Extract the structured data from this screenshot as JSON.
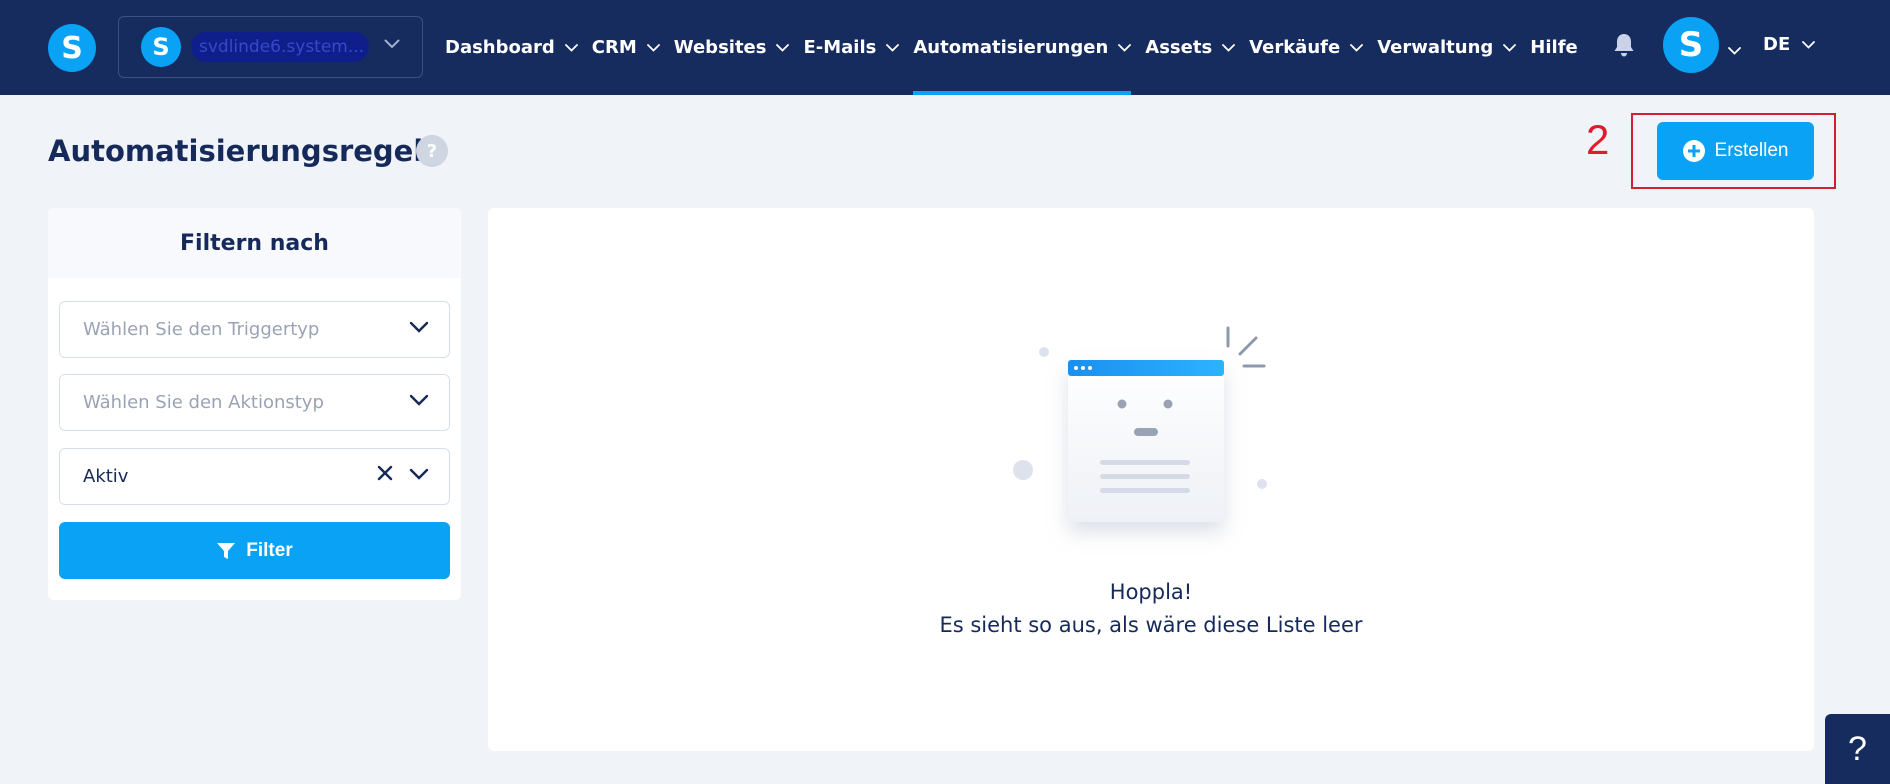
{
  "topbar": {
    "logo_letter": "S",
    "site": {
      "avatar_letter": "S",
      "name": "svdlinde6.system..."
    },
    "nav": [
      {
        "label": "Dashboard",
        "active": false
      },
      {
        "label": "CRM",
        "active": false
      },
      {
        "label": "Websites",
        "active": false
      },
      {
        "label": "E-Mails",
        "active": false
      },
      {
        "label": "Automatisierungen",
        "active": true
      },
      {
        "label": "Assets",
        "active": false
      },
      {
        "label": "Verkäufe",
        "active": false
      },
      {
        "label": "Verwaltung",
        "active": false
      }
    ],
    "help_label": "Hilfe",
    "user_avatar_letter": "S",
    "language": "DE"
  },
  "page": {
    "title": "Automatisierungsregeln",
    "help_badge": "?",
    "annotation_number": "2",
    "create_button": "Erstellen"
  },
  "filter": {
    "header": "Filtern nach",
    "trigger_placeholder": "Wählen Sie den Triggertyp",
    "action_placeholder": "Wählen Sie den Aktionstyp",
    "status_value": "Aktiv",
    "button": "Filter"
  },
  "empty_state": {
    "title": "Hoppla!",
    "subtitle": "Es sieht so aus, als wäre diese Liste leer"
  },
  "help_fab": "?",
  "colors": {
    "topbar": "#162c5e",
    "accent": "#0aa2f5",
    "text": "#152a5a",
    "annotation": "#e01b2b"
  }
}
